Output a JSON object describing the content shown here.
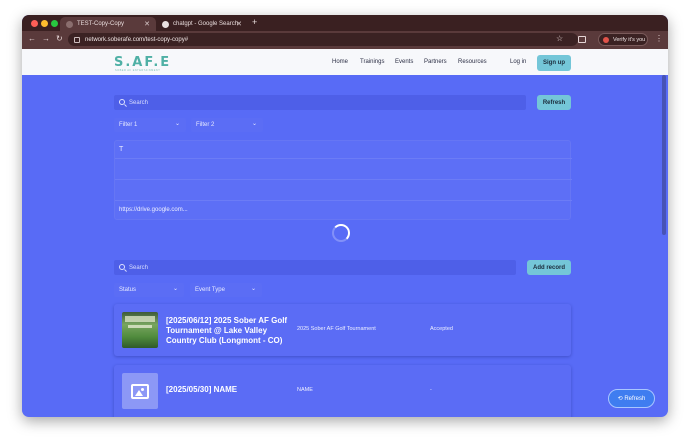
{
  "browser": {
    "tabs": [
      {
        "title": "TEST-Copy-Copy",
        "active": true
      },
      {
        "title": "chatgpt - Google Search",
        "active": false
      }
    ],
    "new_tab": "+",
    "url": "network.soberafe.com/test-copy-copy#",
    "verify_label": "Verify it's you",
    "colors": {
      "frame": "#3a2021",
      "toolbar": "#5a3a3b",
      "traffic_red": "#ff5f57",
      "traffic_yellow": "#febc2e",
      "traffic_green": "#28c840"
    }
  },
  "site": {
    "logo": "S.AF.E",
    "logo_sub": "SOBER AF ENTERTAINMENT",
    "nav": [
      "Home",
      "Trainings",
      "Events",
      "Partners",
      "Resources"
    ],
    "login": "Log in",
    "signup": "Sign up"
  },
  "top_section": {
    "search_placeholder": "Search",
    "refresh_label": "Refresh",
    "filters": [
      "Filter 1",
      "Filter 2"
    ],
    "panel_tool_icon": "T",
    "panel_url": "https://drive.google.com..."
  },
  "records_section": {
    "search_placeholder": "Search",
    "add_label": "Add record",
    "filters": [
      "Status",
      "Event Type"
    ],
    "records": [
      {
        "title": "[2025/06/12] 2025 Sober AF Golf Tournament @ Lake Valley Country Club (Longmont - CO)",
        "name": "2025 Sober AF Golf Tournament",
        "status": "Accepted",
        "thumb": "golf-photo"
      },
      {
        "title": "[2025/05/30] NAME",
        "name": "NAME",
        "status": "-",
        "thumb": "image-placeholder-icon"
      }
    ]
  },
  "floating_refresh": "⟲ Refresh",
  "colors": {
    "page_bg": "#586bf6",
    "accent_cyan": "#74c6d8",
    "logo_teal": "#4fb0a5"
  }
}
